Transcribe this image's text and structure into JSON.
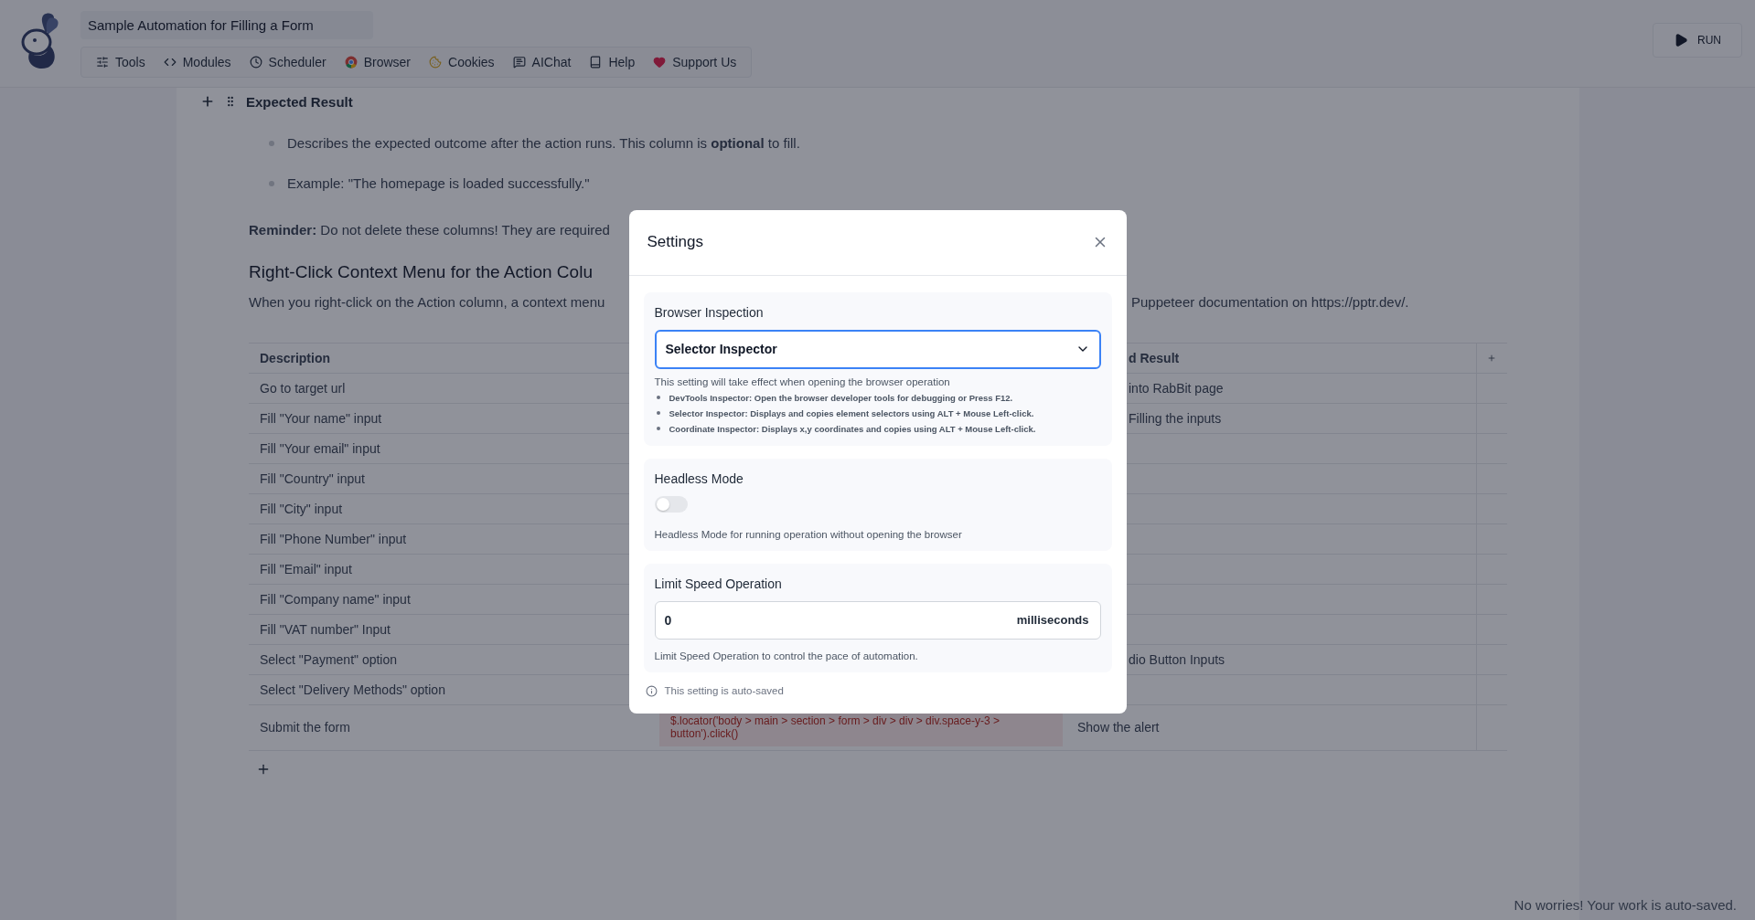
{
  "app": {
    "title": "Sample Automation for Filling a Form",
    "nav": [
      "Tools",
      "Modules",
      "Scheduler",
      "Browser",
      "Cookies",
      "AIChat",
      "Help",
      "Support Us"
    ],
    "run": "RUN"
  },
  "document": {
    "block_title": "Expected Result",
    "bullets": [
      "Describes the expected outcome after the action runs. This column is **optional** to fill.",
      "Example: \"The homepage is loaded successfully.\""
    ],
    "reminder": "**Reminder:** Do not delete these columns! They are required",
    "heading": "Right-Click Context Menu for the Action Colu",
    "paragraph": {
      "left": "When you right-click on the Action column, a context menu",
      "right": "Puppeteer documentation on https://pptr.dev/."
    },
    "table": {
      "column_1": {
        "label": "Description"
      },
      "column_3": {
        "label": "d Result",
        "covered": true
      },
      "rows": [
        {
          "description": "Go to target url",
          "expected_result": {
            "text": "into RabBit page",
            "covered": true
          }
        },
        {
          "description": "Fill \"Your name\" input",
          "expected_result": {
            "text": "Filling the inputs",
            "covered": true
          }
        },
        {
          "description": "Fill \"Your email\" input"
        },
        {
          "description": "Fill \"Country\" input"
        },
        {
          "description": "Fill \"City\" input"
        },
        {
          "description": "Fill \"Phone Number\" input"
        },
        {
          "description": "Fill \"Email\" input"
        },
        {
          "description": "Fill \"Company name\" input"
        },
        {
          "description": "Fill \"VAT number\" Input"
        },
        {
          "description": "Select \"Payment\" option",
          "expected_result": {
            "text": "dio Button Inputs",
            "covered": true
          }
        },
        {
          "description": "Select \"Delivery Methods\" option"
        },
        {
          "description": "Submit the form",
          "action": "$.locator('body > main > section > form > div > div > div.space-y-3 > button').click()",
          "expected_result": {
            "text": "Show the alert"
          }
        }
      ]
    }
  },
  "status_note": "No worries! Your work is auto-saved.",
  "settings_dialog": {
    "title": "Settings",
    "sections": [
      {
        "kind": "select",
        "label": "Browser Inspection",
        "value": "Selector Inspector",
        "focused": true,
        "hint": "This setting will take effect when opening the browser operation",
        "notes": [
          "DevTools Inspector: Open the browser developer tools for debugging or Press F12.",
          "Selector Inspector: Displays and copies element selectors using ALT + Mouse Left-click.",
          "Coordinate Inspector: Displays x,y coordinates and copies using ALT + Mouse Left-click."
        ]
      },
      {
        "kind": "toggle",
        "label": "Headless Mode",
        "on": false,
        "hint": "Headless Mode for running operation without opening the browser"
      },
      {
        "kind": "number",
        "label": "Limit Speed Operation",
        "value": "0",
        "unit": "milliseconds",
        "hint": "Limit Speed Operation to control the pace of automation."
      }
    ],
    "footer": "This setting is auto-saved"
  }
}
